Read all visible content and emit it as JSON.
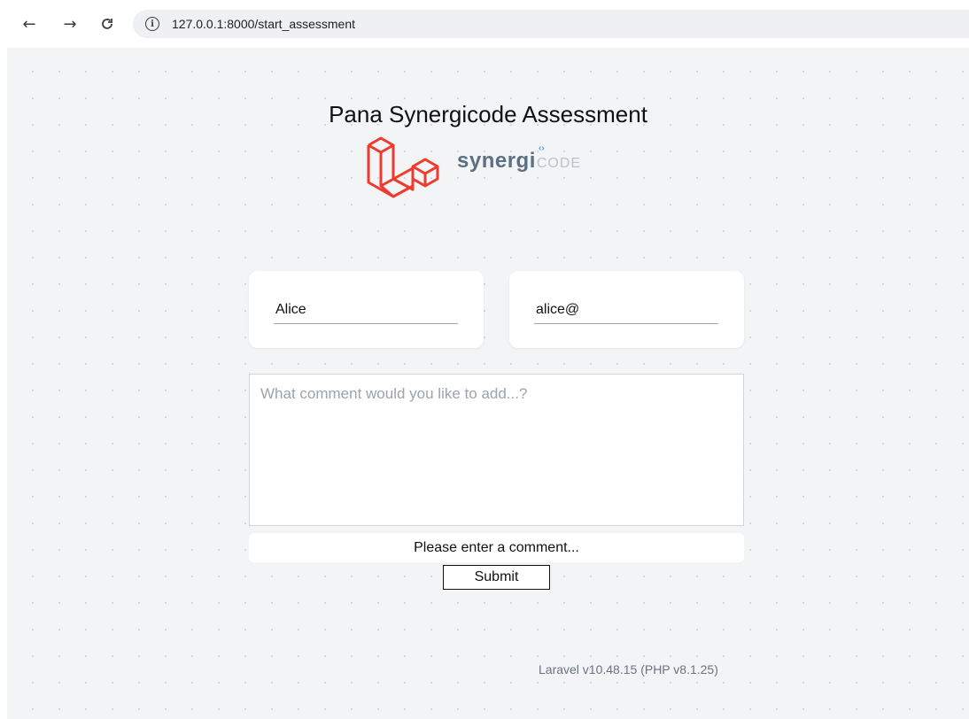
{
  "browser": {
    "back_icon": "arrow-left-icon",
    "forward_icon": "arrow-right-icon",
    "reload_icon": "reload-icon",
    "url": "127.0.0.1:8000/start_assessment"
  },
  "page": {
    "title": "Pana Synergicode Assessment",
    "logo_text_main": "synergi",
    "logo_text_code": "CODE",
    "logo_brackets": "‹›"
  },
  "form": {
    "name_value": "Alice",
    "email_value": "alice@",
    "comment_placeholder": "What comment would you like to add...?",
    "message": "Please enter a comment...",
    "submit_label": "Submit"
  },
  "footer": {
    "version": "Laravel v10.48.15 (PHP v8.1.25)"
  },
  "colors": {
    "laravel_red": "#ef3b2d",
    "page_bg": "#f3f4f6"
  }
}
